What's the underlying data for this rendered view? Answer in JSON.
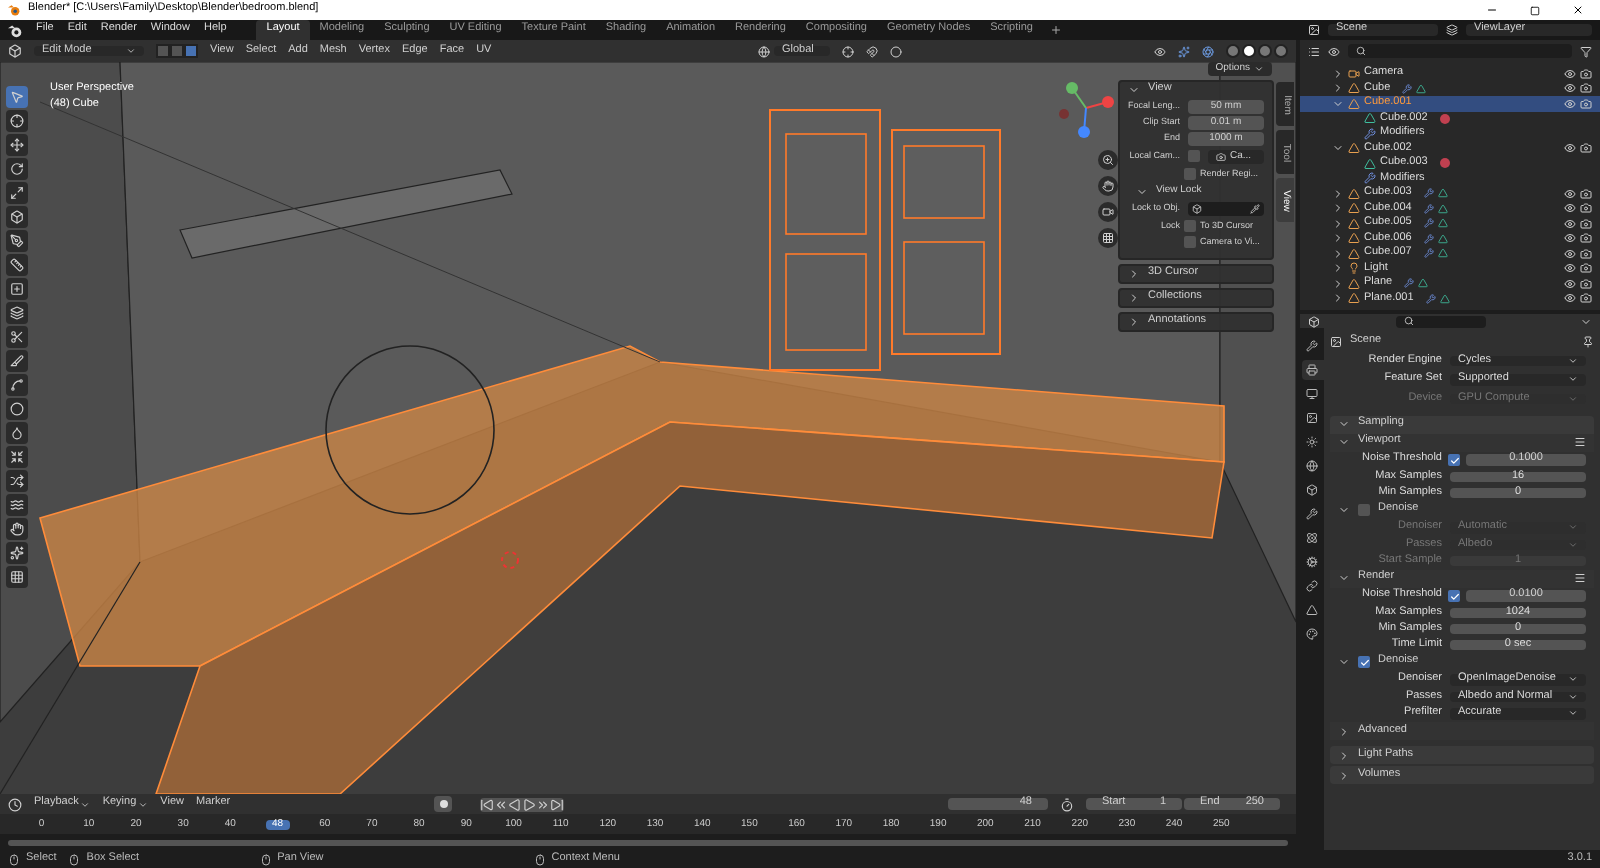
{
  "window": {
    "title": "Blender* [C:\\Users\\Family\\Desktop\\Blender\\bedroom.blend]"
  },
  "menu": [
    "File",
    "Edit",
    "Render",
    "Window",
    "Help"
  ],
  "workspaces": [
    {
      "label": "Layout",
      "selected": true
    },
    {
      "label": "Modeling",
      "selected": false
    },
    {
      "label": "Sculpting",
      "selected": false
    },
    {
      "label": "UV Editing",
      "selected": false
    },
    {
      "label": "Texture Paint",
      "selected": false
    },
    {
      "label": "Shading",
      "selected": false
    },
    {
      "label": "Animation",
      "selected": false
    },
    {
      "label": "Rendering",
      "selected": false
    },
    {
      "label": "Compositing",
      "selected": false
    },
    {
      "label": "Geometry Nodes",
      "selected": false
    },
    {
      "label": "Scripting",
      "selected": false
    }
  ],
  "scene": "Scene",
  "view_layer": "ViewLayer",
  "viewport_header": {
    "mode": "Edit Mode",
    "select_modes": [
      {
        "selected": false
      },
      {
        "selected": false
      },
      {
        "selected": true
      }
    ],
    "menus": [
      "View",
      "Select",
      "Add",
      "Mesh",
      "Vertex",
      "Edge",
      "Face",
      "UV"
    ],
    "orientation": "Global",
    "shading": [
      {
        "selected": false
      },
      {
        "selected": true
      },
      {
        "selected": false
      },
      {
        "selected": false
      }
    ]
  },
  "viewport": {
    "view_name": "User Perspective",
    "object_info": "(48) Cube",
    "options": "Options",
    "tools": [
      {
        "selected": true
      },
      {
        "selected": false
      },
      {
        "selected": false
      },
      {
        "selected": false
      },
      {
        "selected": false
      },
      {
        "selected": false
      },
      {
        "selected": false
      },
      {
        "selected": false
      },
      {
        "selected": false
      },
      {
        "selected": false
      },
      {
        "selected": false
      },
      {
        "selected": false
      },
      {
        "selected": false
      },
      {
        "selected": false
      },
      {
        "selected": false
      },
      {
        "selected": false
      },
      {
        "selected": false
      },
      {
        "selected": false
      },
      {
        "selected": false
      },
      {
        "selected": false
      },
      {
        "selected": false
      }
    ]
  },
  "sidebar": {
    "tabs": [
      {
        "label": "Item",
        "selected": false
      },
      {
        "label": "Tool",
        "selected": false
      },
      {
        "label": "View",
        "selected": true
      }
    ],
    "panels": [
      {
        "label": "View",
        "expanded": true,
        "rows": [
          {
            "kind": "field",
            "label": "Focal Leng...",
            "value": "50 mm"
          },
          {
            "kind": "field",
            "label": "Clip Start",
            "value": "0.01 m"
          },
          {
            "kind": "field",
            "label": "End",
            "value": "1000 m"
          },
          {
            "kind": "check_field",
            "label": "Local Cam...",
            "checked": false,
            "value": "Ca..."
          },
          {
            "kind": "check",
            "label": "",
            "text": "Render Regi...",
            "checked": false
          },
          {
            "kind": "subheader",
            "label": "View Lock",
            "expanded": true
          },
          {
            "kind": "object_field",
            "label": "Lock to Obj."
          },
          {
            "kind": "check",
            "label": "Lock",
            "text": "To 3D Cursor",
            "checked": false
          },
          {
            "kind": "check",
            "label": "",
            "text": "Camera to Vi...",
            "checked": false
          }
        ]
      },
      {
        "label": "3D Cursor",
        "expanded": false
      },
      {
        "label": "Collections",
        "expanded": false
      },
      {
        "label": "Annotations",
        "expanded": false
      }
    ]
  },
  "outliner": {
    "items": [
      {
        "name": "Camera",
        "kind": "camera",
        "selected": false,
        "expanded": false
      },
      {
        "name": "Cube",
        "kind": "mesh",
        "selected": false,
        "expanded": false
      },
      {
        "name": "Cube.001",
        "kind": "mesh",
        "selected": true,
        "expanded": true,
        "children": [
          {
            "name": "Cube.002",
            "kind": "mesh_data",
            "selected": false
          },
          {
            "name": "Modifiers",
            "kind": "modifiers",
            "selected": false
          }
        ]
      },
      {
        "name": "Cube.002",
        "kind": "mesh",
        "selected": false,
        "expanded": true,
        "children": [
          {
            "name": "Cube.003",
            "kind": "mesh_data",
            "selected": false
          },
          {
            "name": "Modifiers",
            "kind": "modifiers",
            "selected": false
          }
        ]
      },
      {
        "name": "Cube.003",
        "kind": "mesh",
        "selected": false,
        "expanded": false
      },
      {
        "name": "Cube.004",
        "kind": "mesh",
        "selected": false,
        "expanded": false
      },
      {
        "name": "Cube.005",
        "kind": "mesh",
        "selected": false,
        "expanded": false
      },
      {
        "name": "Cube.006",
        "kind": "mesh",
        "selected": false,
        "expanded": false
      },
      {
        "name": "Cube.007",
        "kind": "mesh",
        "selected": false,
        "expanded": false
      },
      {
        "name": "Light",
        "kind": "light",
        "selected": false,
        "expanded": false
      },
      {
        "name": "Plane",
        "kind": "mesh",
        "selected": false,
        "expanded": false
      },
      {
        "name": "Plane.001",
        "kind": "mesh",
        "selected": false,
        "expanded": false
      }
    ]
  },
  "properties": {
    "tabs": [
      {
        "selected": false
      },
      {
        "selected": true
      },
      {
        "selected": false
      },
      {
        "selected": false
      },
      {
        "selected": false
      },
      {
        "selected": false
      },
      {
        "selected": false
      },
      {
        "selected": false
      },
      {
        "selected": false
      },
      {
        "selected": false
      },
      {
        "selected": false
      },
      {
        "selected": false
      },
      {
        "selected": false
      }
    ],
    "context": "Scene",
    "fields": [
      {
        "kind": "dropdown",
        "label": "Render Engine",
        "value": "Cycles",
        "disabled": false
      },
      {
        "kind": "dropdown",
        "label": "Feature Set",
        "value": "Supported",
        "disabled": false
      },
      {
        "kind": "dropdown",
        "label": "Device",
        "value": "GPU Compute",
        "disabled": true
      }
    ],
    "panels": [
      {
        "label": "Sampling",
        "expanded": true,
        "rows": [
          {
            "kind": "subheader",
            "label": "Viewport",
            "expanded": true
          },
          {
            "kind": "check_number",
            "label": "Noise Threshold",
            "checked": true,
            "value": "0.1000"
          },
          {
            "kind": "number",
            "label": "Max Samples",
            "value": "16",
            "disabled": false
          },
          {
            "kind": "number",
            "label": "Min Samples",
            "value": "0",
            "disabled": false
          },
          {
            "kind": "check_subheader",
            "label": "Denoise",
            "checked": false,
            "expanded": true
          },
          {
            "kind": "dropdown",
            "label": "Denoiser",
            "value": "Automatic",
            "disabled": true
          },
          {
            "kind": "dropdown",
            "label": "Passes",
            "value": "Albedo",
            "disabled": true
          },
          {
            "kind": "number",
            "label": "Start Sample",
            "value": "1",
            "disabled": true
          },
          {
            "kind": "subheader",
            "label": "Render",
            "expanded": true
          },
          {
            "kind": "check_number",
            "label": "Noise Threshold",
            "checked": true,
            "value": "0.0100"
          },
          {
            "kind": "number",
            "label": "Max Samples",
            "value": "1024",
            "disabled": false
          },
          {
            "kind": "number",
            "label": "Min Samples",
            "value": "0",
            "disabled": false
          },
          {
            "kind": "number",
            "label": "Time Limit",
            "value": "0 sec",
            "disabled": false
          },
          {
            "kind": "check_subheader",
            "label": "Denoise",
            "checked": true,
            "expanded": true
          },
          {
            "kind": "dropdown",
            "label": "Denoiser",
            "value": "OpenImageDenoise",
            "disabled": false
          },
          {
            "kind": "dropdown",
            "label": "Passes",
            "value": "Albedo and Normal",
            "disabled": false
          },
          {
            "kind": "dropdown",
            "label": "Prefilter",
            "value": "Accurate",
            "disabled": false
          },
          {
            "kind": "subheader",
            "label": "Advanced",
            "expanded": false
          }
        ]
      },
      {
        "label": "Light Paths",
        "expanded": false
      },
      {
        "label": "Volumes",
        "expanded": false
      }
    ]
  },
  "timeline": {
    "menus": [
      "Playback",
      "Keying",
      "View",
      "Marker"
    ],
    "current_frame": "48",
    "start_label": "Start",
    "start": "1",
    "end_label": "End",
    "end": "250",
    "ruler": [
      {
        "kind": "tick",
        "label": "0"
      },
      {
        "kind": "tick",
        "label": "10"
      },
      {
        "kind": "tick",
        "label": "20"
      },
      {
        "kind": "tick",
        "label": "30"
      },
      {
        "kind": "tick",
        "label": "40"
      },
      {
        "kind": "playhead",
        "label": "48"
      },
      {
        "kind": "tick",
        "label": "60"
      },
      {
        "kind": "tick",
        "label": "70"
      },
      {
        "kind": "tick",
        "label": "80"
      },
      {
        "kind": "tick",
        "label": "90"
      },
      {
        "kind": "tick",
        "label": "100"
      },
      {
        "kind": "tick",
        "label": "110"
      },
      {
        "kind": "tick",
        "label": "120"
      },
      {
        "kind": "tick",
        "label": "130"
      },
      {
        "kind": "tick",
        "label": "140"
      },
      {
        "kind": "tick",
        "label": "150"
      },
      {
        "kind": "tick",
        "label": "160"
      },
      {
        "kind": "tick",
        "label": "170"
      },
      {
        "kind": "tick",
        "label": "180"
      },
      {
        "kind": "tick",
        "label": "190"
      },
      {
        "kind": "tick",
        "label": "200"
      },
      {
        "kind": "tick",
        "label": "210"
      },
      {
        "kind": "tick",
        "label": "220"
      },
      {
        "kind": "tick",
        "label": "230"
      },
      {
        "kind": "tick",
        "label": "240"
      },
      {
        "kind": "tick",
        "label": "250"
      }
    ]
  },
  "status_bar": {
    "hints": [
      "Select",
      "Box Select",
      "Pan View",
      "Context Menu"
    ],
    "version": "3.0.1"
  }
}
